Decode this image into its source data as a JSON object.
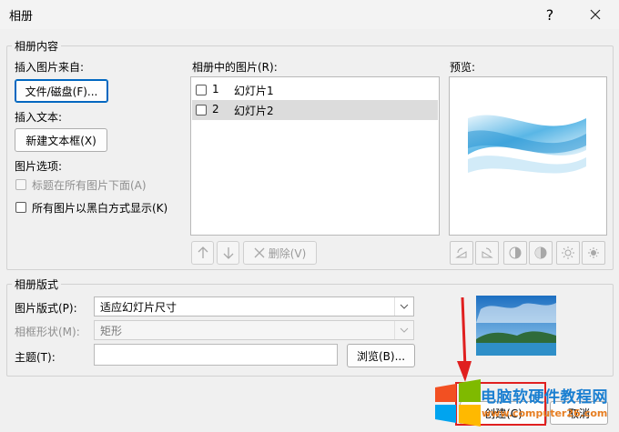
{
  "window": {
    "title": "相册",
    "help_label": "?",
    "close_label": "✕"
  },
  "album_content": {
    "legend": "相册内容",
    "insert_from_label": "插入图片来自:",
    "file_disk_button": "文件/磁盘(F)...",
    "insert_text_label": "插入文本:",
    "new_textbox_button": "新建文本框(X)",
    "picture_options_label": "图片选项:",
    "caption_below_label": "标题在所有图片下面(A)",
    "caption_below_checked": false,
    "black_white_label": "所有图片以黑白方式显示(K)",
    "black_white_checked": false,
    "pictures_in_album_label": "相册中的图片(R):",
    "pictures": [
      {
        "index": "1",
        "name": "幻灯片1",
        "selected": false
      },
      {
        "index": "2",
        "name": "幻灯片2",
        "selected": true
      }
    ],
    "delete_button": "删除(V)",
    "preview_label": "预览:"
  },
  "album_layout": {
    "legend": "相册版式",
    "picture_layout_label": "图片版式(P):",
    "picture_layout_value": "适应幻灯片尺寸",
    "frame_shape_label": "相框形状(M):",
    "frame_shape_value": "矩形",
    "theme_label": "主题(T):",
    "theme_value": "",
    "browse_button": "浏览(B)..."
  },
  "footer": {
    "create_button": "创建(C)",
    "cancel_button": "取消"
  },
  "watermark": {
    "text1": "电脑软硬件教程网",
    "text2": "www.computer26.com"
  },
  "colors": {
    "accent": "#0067c0",
    "annotation_red": "#e02020"
  }
}
